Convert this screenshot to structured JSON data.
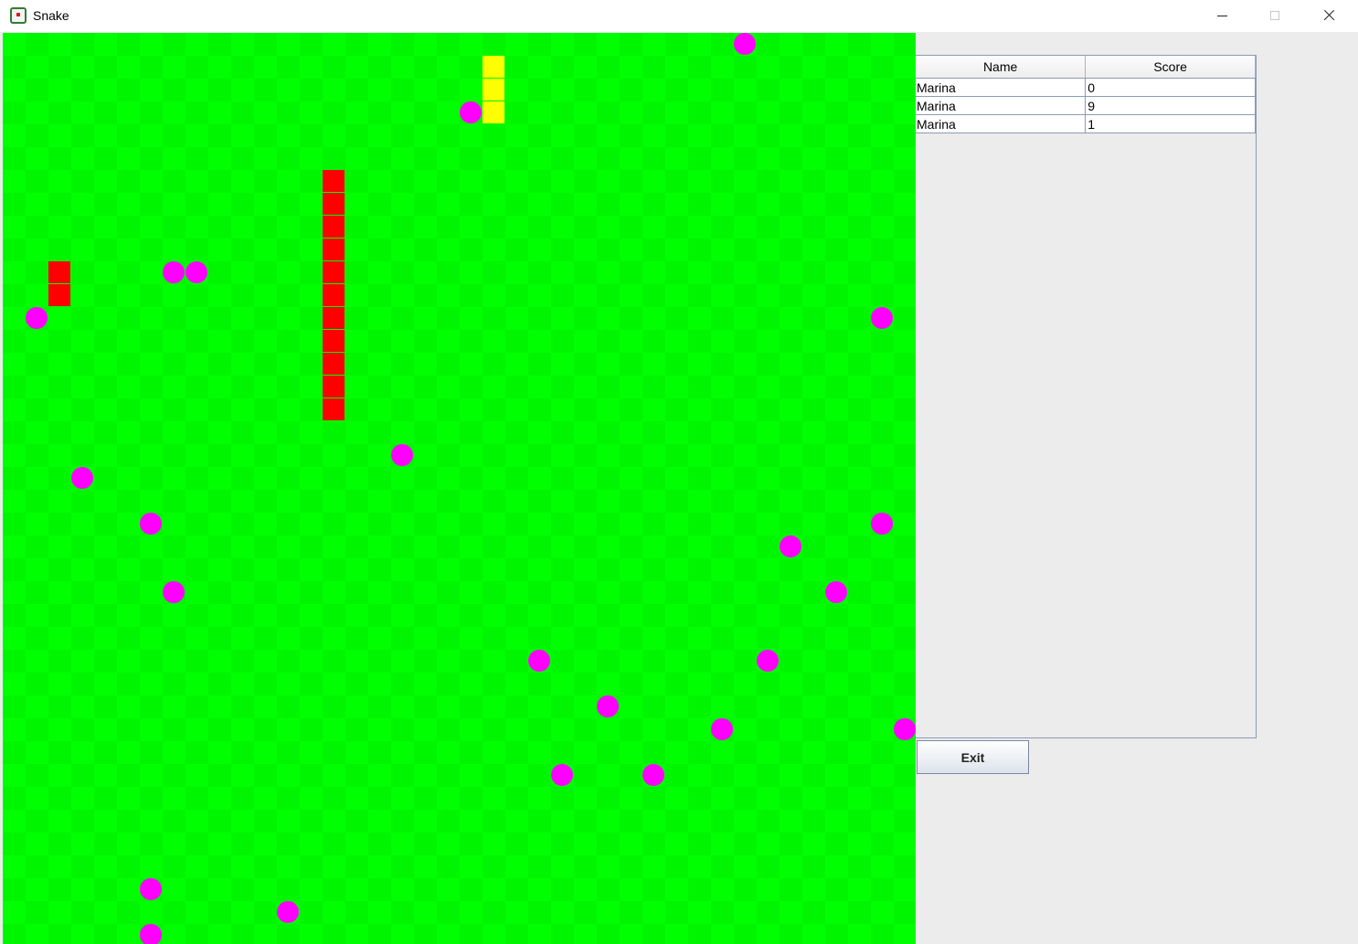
{
  "window": {
    "title": "Snake",
    "app_icon": "snake-app-icon",
    "controls": [
      "minimize-icon",
      "maximize-icon",
      "close-icon"
    ]
  },
  "board": {
    "background_color": "#00ff00",
    "checker_color": "#00f600",
    "grid_size": 40,
    "snakes": [
      {
        "color": "#ffff00",
        "cells": [
          [
            21,
            1
          ],
          [
            21,
            2
          ],
          [
            21,
            3
          ]
        ]
      },
      {
        "color": "#ff0000",
        "cells": [
          [
            14,
            6
          ],
          [
            14,
            7
          ],
          [
            14,
            8
          ],
          [
            14,
            9
          ],
          [
            14,
            10
          ],
          [
            14,
            11
          ],
          [
            14,
            12
          ],
          [
            14,
            13
          ],
          [
            14,
            14
          ],
          [
            14,
            15
          ],
          [
            14,
            16
          ]
        ]
      },
      {
        "color": "#ff0000",
        "cells": [
          [
            2,
            10
          ],
          [
            2,
            11
          ]
        ]
      }
    ],
    "food_color": "#ff00ff",
    "food": [
      [
        32,
        0
      ],
      [
        20,
        3
      ],
      [
        7,
        10
      ],
      [
        8,
        10
      ],
      [
        1,
        12
      ],
      [
        38,
        12
      ],
      [
        17,
        18
      ],
      [
        3,
        19
      ],
      [
        6,
        21
      ],
      [
        38,
        21
      ],
      [
        34,
        22
      ],
      [
        7,
        24
      ],
      [
        36,
        24
      ],
      [
        23,
        27
      ],
      [
        33,
        27
      ],
      [
        26,
        29
      ],
      [
        31,
        30
      ],
      [
        39,
        30
      ],
      [
        24,
        32
      ],
      [
        28,
        32
      ],
      [
        6,
        37
      ],
      [
        12,
        38
      ],
      [
        6,
        39
      ]
    ]
  },
  "scores": {
    "columns": [
      "Name",
      "Score"
    ],
    "rows": [
      {
        "name": "Marina",
        "score": "0"
      },
      {
        "name": "Marina",
        "score": "9"
      },
      {
        "name": "Marina",
        "score": "1"
      }
    ]
  },
  "actions": {
    "exit_label": "Exit"
  }
}
